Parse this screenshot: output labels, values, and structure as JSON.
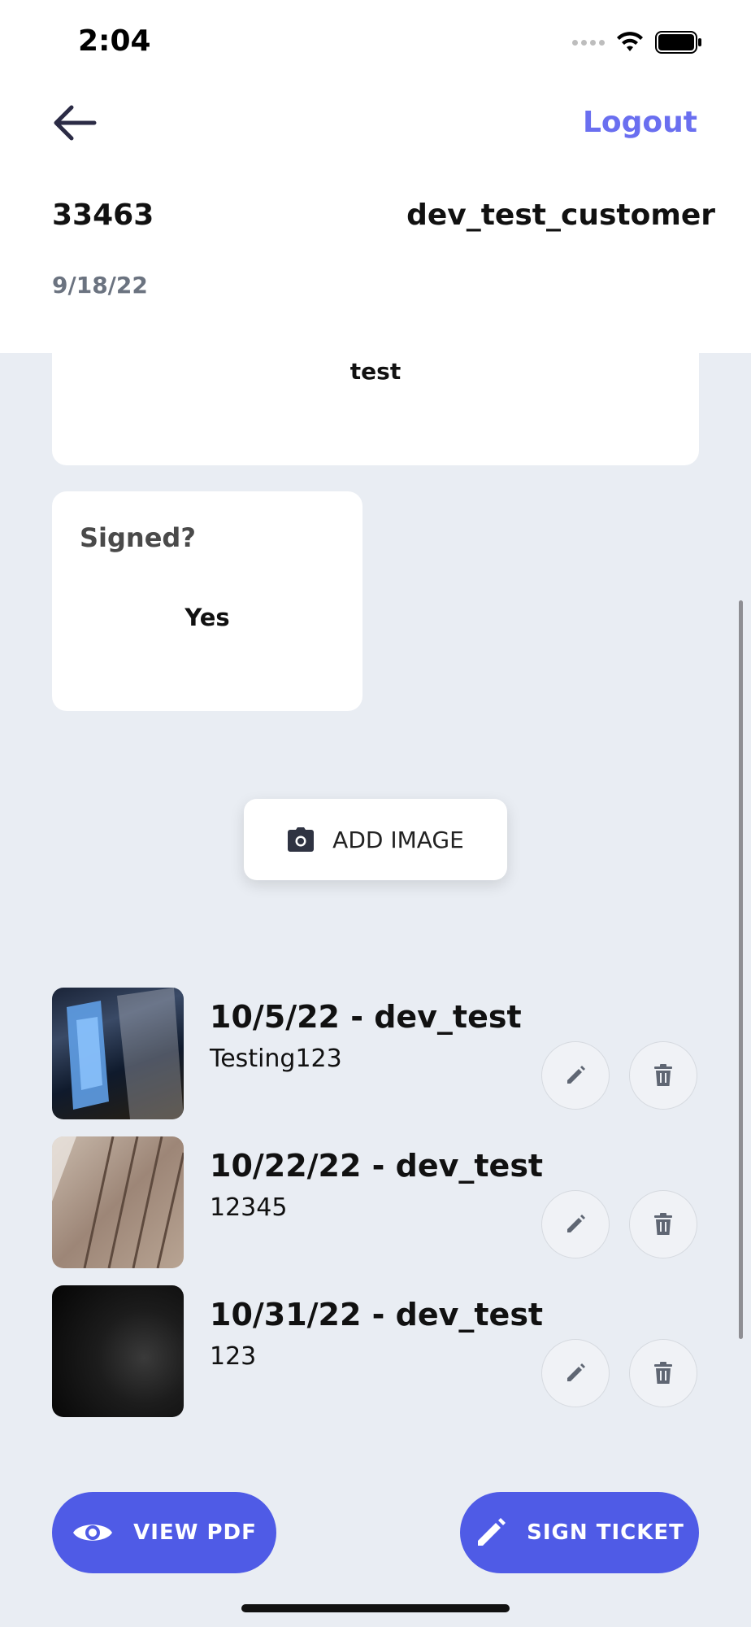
{
  "status_bar": {
    "time": "2:04"
  },
  "nav": {
    "logout_label": "Logout"
  },
  "ticket": {
    "number": "33463",
    "customer": "dev_test_customer",
    "date": "9/18/22"
  },
  "description_card": {
    "value": "test"
  },
  "signed_card": {
    "label": "Signed?",
    "value": "Yes"
  },
  "add_image": {
    "label": "ADD IMAGE"
  },
  "images": [
    {
      "title": "10/5/22 - dev_test",
      "caption": "Testing123"
    },
    {
      "title": "10/22/22 - dev_test",
      "caption": "12345"
    },
    {
      "title": "10/31/22 - dev_test",
      "caption": "123"
    }
  ],
  "actions": {
    "view_pdf": "VIEW PDF",
    "sign_ticket": "SIGN TICKET"
  },
  "colors": {
    "accent": "#4f5be6",
    "logout": "#6a6ff0",
    "background": "#e9edf3"
  }
}
